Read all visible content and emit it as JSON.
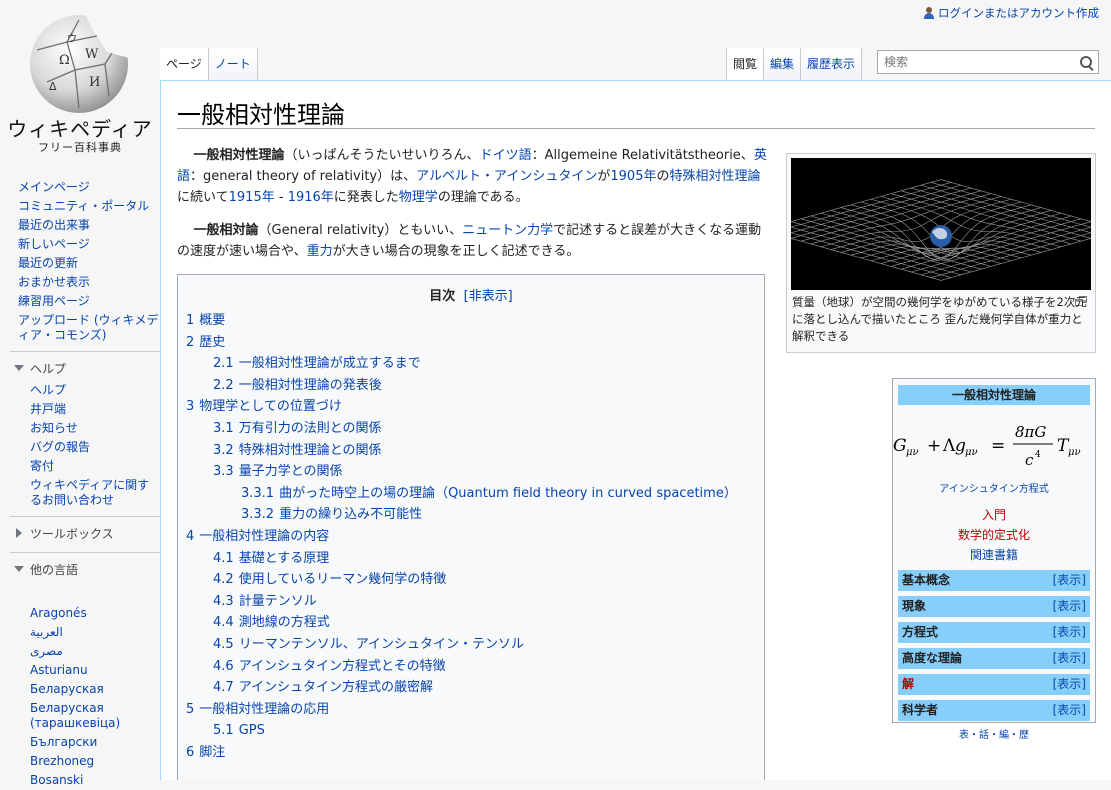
{
  "personal": {
    "login": "ログインまたはアカウント作成"
  },
  "logo": {
    "wordmark": "ウィキペディア",
    "tagline": "フリー百科事典"
  },
  "sidebar": {
    "nav": [
      "メインページ",
      "コミュニティ・ポータル",
      "最近の出来事",
      "新しいページ",
      "最近の更新",
      "おまかせ表示",
      "練習用ページ",
      "アップロード (ウィキメディア・コモンズ)"
    ],
    "help": {
      "heading": "ヘルプ",
      "items": [
        "ヘルプ",
        "井戸端",
        "お知らせ",
        "バグの報告",
        "寄付",
        "ウィキペディアに関するお問い合わせ"
      ]
    },
    "toolbox": {
      "heading": "ツールボックス"
    },
    "languages": {
      "heading": "他の言語",
      "items": [
        "Aragonés",
        "العربية",
        "مصرى",
        "Asturianu",
        "Беларуская",
        "Беларуская (тарашкевіца)",
        "Български",
        "Brezhoneg",
        "Bosanski"
      ]
    }
  },
  "tabs": {
    "left": [
      {
        "label": "ページ",
        "selected": true
      },
      {
        "label": "ノート",
        "selected": false
      }
    ],
    "right": [
      {
        "label": "閲覧",
        "selected": true
      },
      {
        "label": "編集",
        "selected": false
      },
      {
        "label": "履歴表示",
        "selected": false
      }
    ]
  },
  "search": {
    "placeholder": "検索"
  },
  "article": {
    "title": "一般相対性理論",
    "p1": {
      "bold": "一般相対性理論",
      "t1": "（いっぱんそうたいせいりろん、",
      "l1": "ドイツ語",
      "t2": "：Allgemeine Relativitätstheorie、",
      "l2": "英語",
      "t3": "：general theory of relativity）は、",
      "l3": "アルベルト・アインシュタイン",
      "t4": "が",
      "l4": "1905年",
      "t5": "の",
      "l5": "特殊相対性理論",
      "t6": "に続いて",
      "l6": "1915年",
      "t7": " - ",
      "l7": "1916年",
      "t8": "に発表した",
      "l8": "物理学",
      "t9": "の理論である。"
    },
    "p2": {
      "bold": "一般相対論",
      "t1": "（General relativity）ともいい、",
      "l1": "ニュートン力学",
      "t2": "で記述すると誤差が大きくなる運動の速度が速い場合や、",
      "l2": "重力",
      "t3": "が大きい場合の現象を正しく記述できる。"
    }
  },
  "thumb": {
    "caption": "質量（地球）が空間の幾何学をゆがめている様子を2次元に落とし込んで描いたところ 歪んだ幾何学自体が重力と解釈できる"
  },
  "toc": {
    "title": "目次",
    "toggle": "[非表示]",
    "items": [
      {
        "num": "1",
        "label": "概要",
        "level": 1
      },
      {
        "num": "2",
        "label": "歴史",
        "level": 1
      },
      {
        "num": "2.1",
        "label": "一般相対性理論が成立するまで",
        "level": 2
      },
      {
        "num": "2.2",
        "label": "一般相対性理論の発表後",
        "level": 2
      },
      {
        "num": "3",
        "label": "物理学としての位置づけ",
        "level": 1
      },
      {
        "num": "3.1",
        "label": "万有引力の法則との関係",
        "level": 2
      },
      {
        "num": "3.2",
        "label": "特殊相対性理論との関係",
        "level": 2
      },
      {
        "num": "3.3",
        "label": "量子力学との関係",
        "level": 2
      },
      {
        "num": "3.3.1",
        "label": "曲がった時空上の場の理論（Quantum field theory in curved spacetime）",
        "level": 3
      },
      {
        "num": "3.3.2",
        "label": "重力の繰り込み不可能性",
        "level": 3
      },
      {
        "num": "4",
        "label": "一般相対性理論の内容",
        "level": 1
      },
      {
        "num": "4.1",
        "label": "基礎とする原理",
        "level": 2
      },
      {
        "num": "4.2",
        "label": "使用しているリーマン幾何学の特徴",
        "level": 2
      },
      {
        "num": "4.3",
        "label": "計量テンソル",
        "level": 2
      },
      {
        "num": "4.4",
        "label": "測地線の方程式",
        "level": 2
      },
      {
        "num": "4.5",
        "label": "リーマンテンソル、アインシュタイン・テンソル",
        "level": 2
      },
      {
        "num": "4.6",
        "label": "アインシュタイン方程式とその特徴",
        "level": 2
      },
      {
        "num": "4.7",
        "label": "アインシュタイン方程式の厳密解",
        "level": 2
      },
      {
        "num": "5",
        "label": "一般相対性理論の応用",
        "level": 1
      },
      {
        "num": "5.1",
        "label": "GPS",
        "level": 2
      },
      {
        "num": "6",
        "label": "脚注",
        "level": 1
      }
    ]
  },
  "navbox": {
    "title": "一般相対性理論",
    "formula": {
      "G": "G",
      "sub_mn": "μν",
      "plus": "+",
      "lambda": "Λ",
      "g": "g",
      "eq": "=",
      "num": "8πG",
      "den": "c",
      "den_pow": "4",
      "T": "T"
    },
    "formula_caption": "アインシュタイン方程式",
    "links": [
      {
        "label": "入門",
        "red": true
      },
      {
        "label": "数学的定式化",
        "red": true
      },
      {
        "label": "関連書籍",
        "red": false
      }
    ],
    "rows": [
      {
        "label": "基本概念",
        "toggle": "[表示]",
        "red": false
      },
      {
        "label": "現象",
        "toggle": "[表示]",
        "red": false
      },
      {
        "label": "方程式",
        "toggle": "[表示]",
        "red": false
      },
      {
        "label": "高度な理論",
        "toggle": "[表示]",
        "red": false
      },
      {
        "label": "解",
        "toggle": "[表示]",
        "red": true
      },
      {
        "label": "科学者",
        "toggle": "[表示]",
        "red": false
      }
    ],
    "footer": "表・話・編・歴"
  }
}
